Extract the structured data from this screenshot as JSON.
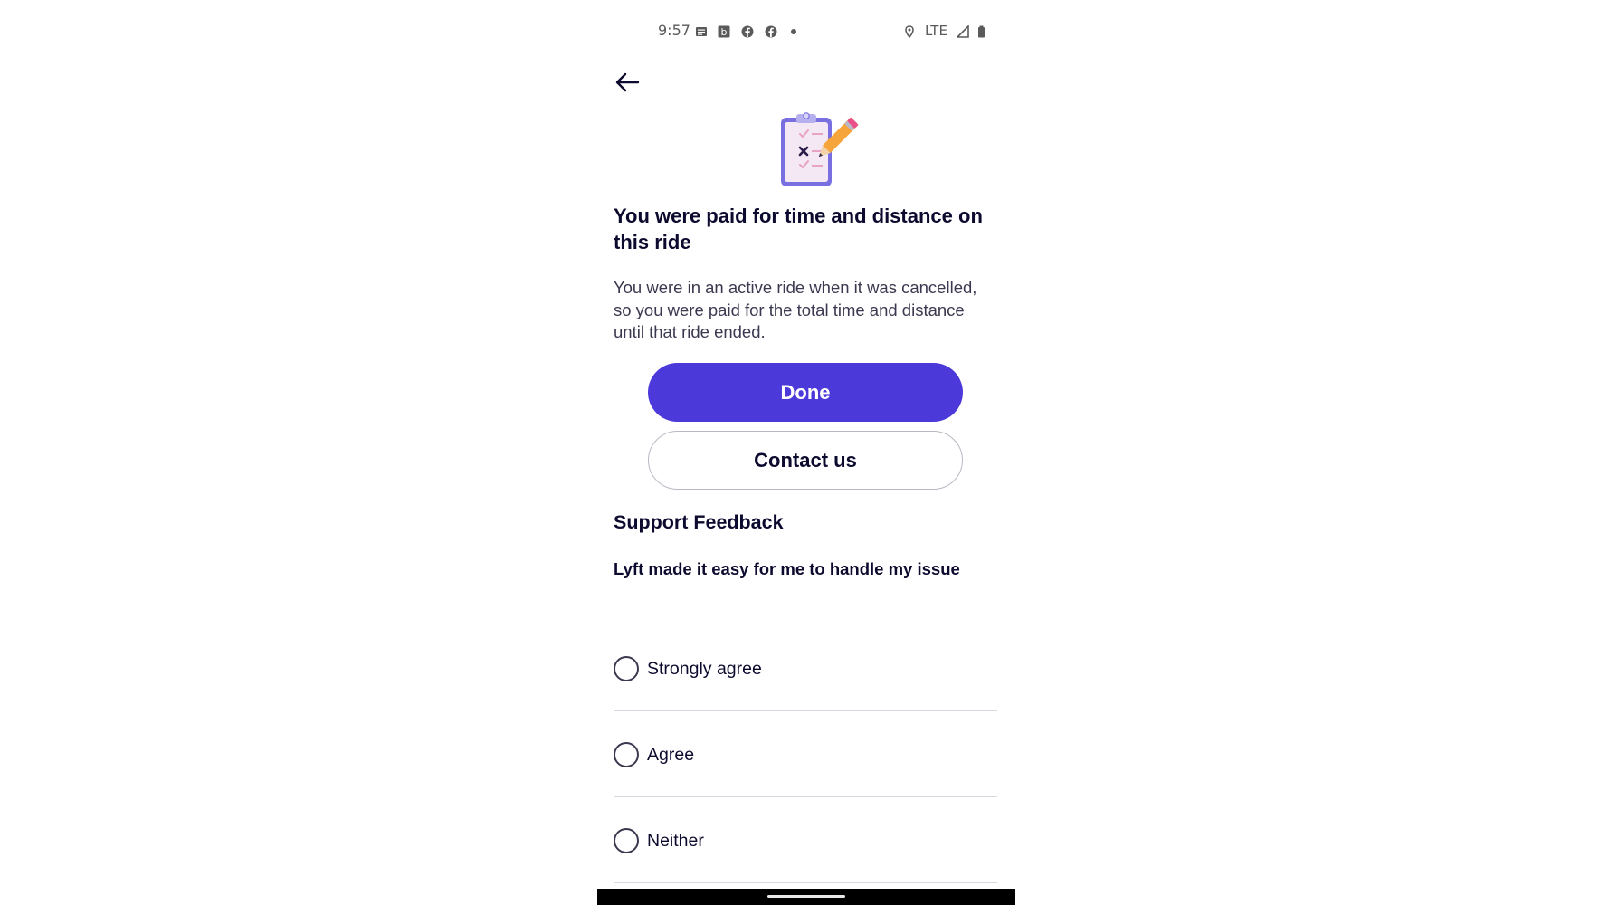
{
  "status_bar": {
    "time": "9:57",
    "network": "LTE",
    "icons": [
      "message-icon",
      "b-app-icon",
      "facebook-icon",
      "facebook-icon",
      "dot-icon",
      "location-icon",
      "signal-icon",
      "battery-icon"
    ]
  },
  "header": {
    "back_icon": "back-arrow-icon"
  },
  "illustration": {
    "icon": "clipboard-pencil-icon"
  },
  "content": {
    "title": "You were paid for time and distance on this ride",
    "body": "You were in an active ride when it was cancelled, so you were paid for the total time and distance until that ride ended."
  },
  "actions": {
    "done_label": "Done",
    "contact_label": "Contact us"
  },
  "feedback": {
    "section_title": "Support Feedback",
    "question": "Lyft made it easy for me to handle my issue",
    "options": [
      {
        "label": "Strongly agree",
        "selected": false
      },
      {
        "label": "Agree",
        "selected": false
      },
      {
        "label": "Neither",
        "selected": false
      }
    ]
  },
  "colors": {
    "primary": "#4c39d9",
    "text": "#0c0a2e",
    "secondary_text": "#3a3950",
    "divider": "#d9d8e0"
  }
}
